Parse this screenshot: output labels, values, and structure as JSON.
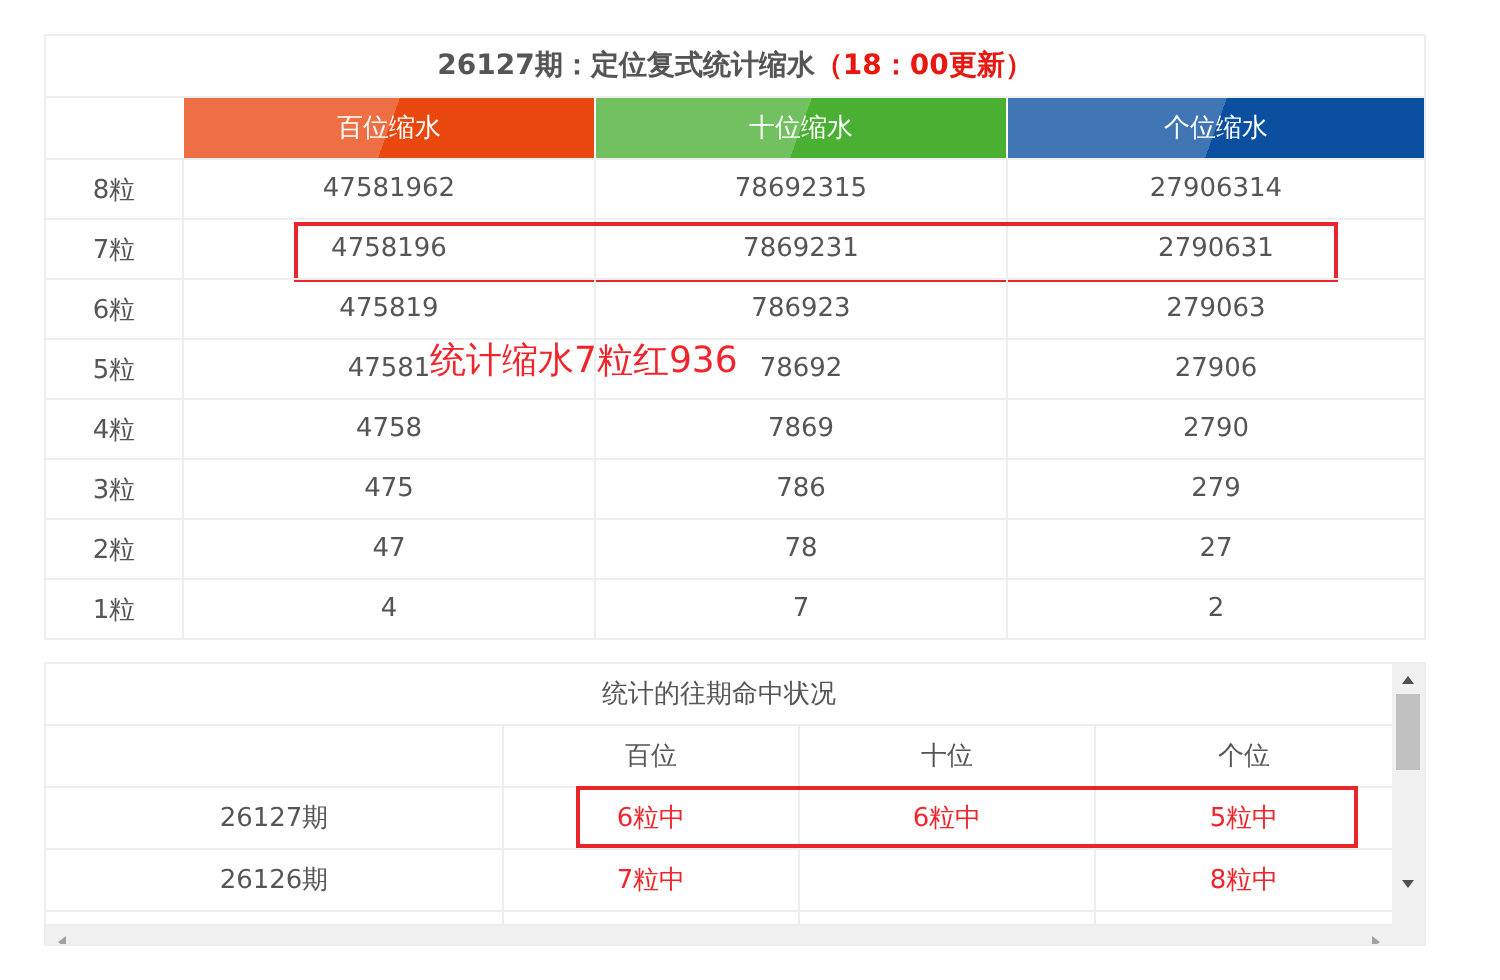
{
  "top_table": {
    "title": "26127期：定位复式统计缩水",
    "title_note": "（18：00更新）",
    "columns": [
      {
        "label": "百位缩水",
        "color": "#e8470e"
      },
      {
        "label": "十位缩水",
        "color": "#4ab034"
      },
      {
        "label": "个位缩水",
        "color": "#0b4fa0"
      }
    ],
    "rows": [
      {
        "label": "8粒",
        "values": [
          "47581962",
          "78692315",
          "27906314"
        ],
        "boxed": false
      },
      {
        "label": "7粒",
        "values": [
          "4758196",
          "7869231",
          "2790631"
        ],
        "boxed": true
      },
      {
        "label": "6粒",
        "values": [
          "475819",
          "786923",
          "279063"
        ],
        "boxed": false
      },
      {
        "label": "5粒",
        "values": [
          "47581",
          "78692",
          "27906"
        ],
        "boxed": false
      },
      {
        "label": "4粒",
        "values": [
          "4758",
          "7869",
          "2790"
        ],
        "boxed": false
      },
      {
        "label": "3粒",
        "values": [
          "475",
          "786",
          "279"
        ],
        "boxed": false
      },
      {
        "label": "2粒",
        "values": [
          "47",
          "78",
          "27"
        ],
        "boxed": false
      },
      {
        "label": "1粒",
        "values": [
          "4",
          "7",
          "2"
        ],
        "boxed": false
      }
    ],
    "overlay_note": "统计缩水7粒红936"
  },
  "history_table": {
    "title": "统计的往期命中状况",
    "columns": [
      "百位",
      "十位",
      "个位"
    ],
    "rows": [
      {
        "period": "26127期",
        "hundreds": "6粒中",
        "tens": "6粒中",
        "units": "5粒中",
        "boxed": true
      },
      {
        "period": "26126期",
        "hundreds": "7粒中",
        "units": "8粒中",
        "boxed": false
      }
    ]
  }
}
